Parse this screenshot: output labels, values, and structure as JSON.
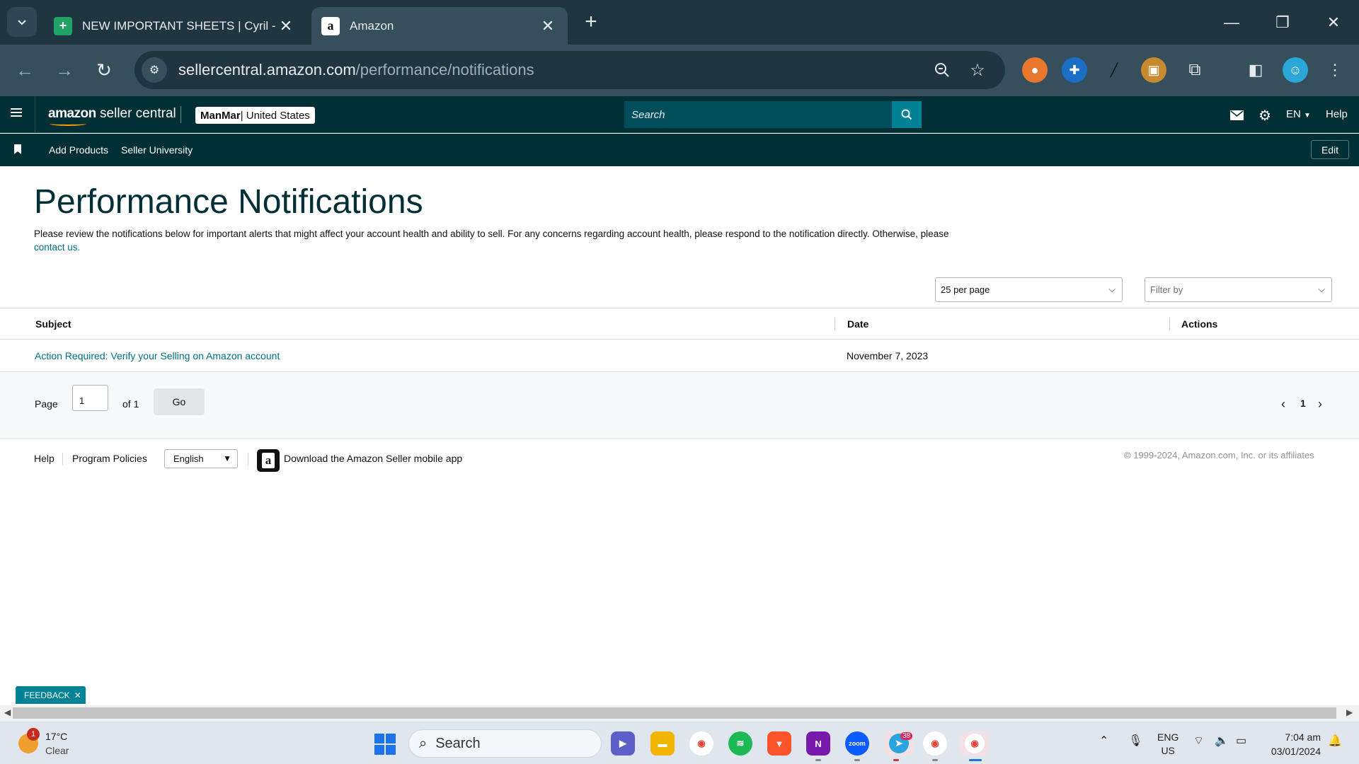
{
  "browser": {
    "tabs": [
      {
        "title": "NEW IMPORTANT SHEETS | Cyril - ",
        "favicon": "sheets-icon"
      },
      {
        "title": "Amazon",
        "favicon": "amazon-icon"
      }
    ],
    "url_domain": "sellercentral.amazon.com",
    "url_path": "/performance/notifications"
  },
  "header": {
    "logo_amazon": "amazon",
    "logo_product": " seller central",
    "account_name": "ManMar",
    "account_region": " | United States",
    "search_placeholder": "Search",
    "language": "EN",
    "help": "Help"
  },
  "subnav": {
    "links": [
      "Add Products",
      "Seller University"
    ],
    "edit_label": "Edit"
  },
  "page": {
    "title": "Performance Notifications",
    "description": "Please review the notifications below for important alerts that might affect your account health and ability to sell. For any concerns regarding account health, please respond to the notification directly. Otherwise, please ",
    "contact_link": "contact us.",
    "per_page": "25 per page",
    "filter_placeholder": "Filter by"
  },
  "table": {
    "columns": [
      "Subject",
      "Date",
      "Actions"
    ],
    "rows": [
      {
        "subject": "Action Required: Verify your Selling on Amazon account",
        "date": "November 7, 2023",
        "actions": ""
      }
    ]
  },
  "pagination": {
    "page_label": "Page",
    "current_page": "1",
    "of_label": "of 1",
    "go_label": "Go",
    "page_number": "1"
  },
  "footer": {
    "help": "Help",
    "program_policies": "Program Policies",
    "language": "English",
    "download_app": "Download the Amazon Seller mobile app",
    "copyright": "© 1999-2024, Amazon.com, Inc. or its affiliates"
  },
  "feedback": {
    "label": "FEEDBACK"
  },
  "taskbar": {
    "weather_temp": "17°C",
    "weather_cond": "Clear",
    "weather_badge": "1",
    "search_label": "Search",
    "telegram_badge": "38",
    "lang_line1": "ENG",
    "lang_line2": "US",
    "time": "7:04 am",
    "date": "03/01/2024"
  },
  "colors": {
    "header_bg": "#002f36",
    "link": "#007185",
    "title": "#002f36",
    "search_button": "#008296"
  }
}
